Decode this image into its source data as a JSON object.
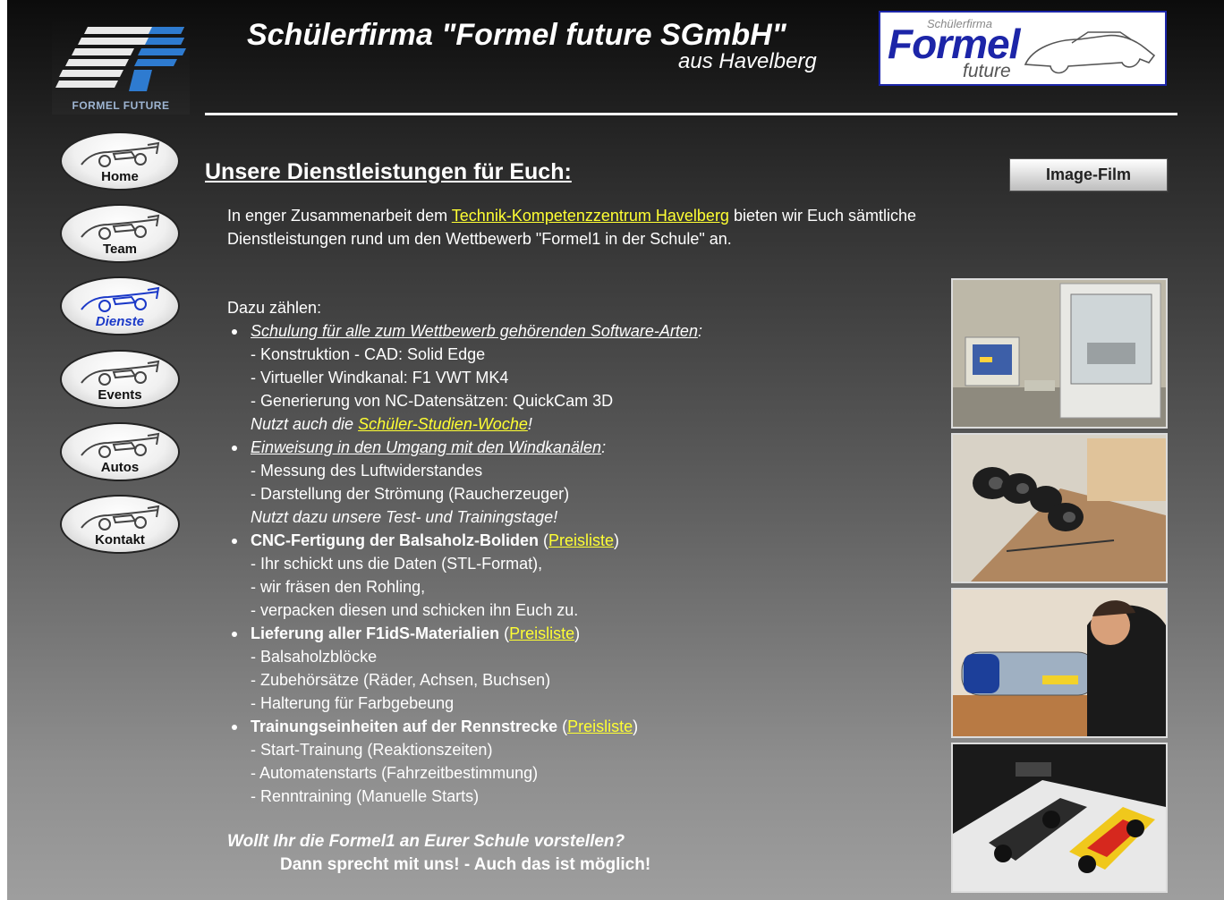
{
  "header": {
    "title": "Schülerfirma \"Formel future SGmbH\"",
    "subtitle": "aus Havelberg",
    "logo": {
      "caption": "FORMEL FUTURE",
      "icon": "ff-logo"
    },
    "banner": {
      "small_text": "Schülerfirma",
      "big_text": "Formel",
      "sub_text": "future",
      "icon": "car-outline"
    }
  },
  "nav": {
    "items": [
      {
        "label": "Home",
        "icon": "race-car-icon",
        "active": false
      },
      {
        "label": "Team",
        "icon": "race-car-icon",
        "active": false
      },
      {
        "label": "Dienste",
        "icon": "race-car-icon",
        "active": true
      },
      {
        "label": "Events",
        "icon": "race-car-icon",
        "active": false
      },
      {
        "label": "Autos",
        "icon": "race-car-icon",
        "active": false
      },
      {
        "label": "Kontakt",
        "icon": "race-car-icon",
        "active": false
      }
    ]
  },
  "main": {
    "heading": "Unsere Dienstleistungen für Euch:",
    "image_film_button": "Image-Film",
    "intro": {
      "before": "In enger Zusammenarbeit dem ",
      "link": "Technik-Kompetenzzentrum Havelberg",
      "after_line1": " bieten wir Euch sämtliche",
      "line2": "Dienstleistungen rund um den Wettbewerb \"Formel1 in der Schule\" an."
    },
    "dazu": "Dazu zählen:",
    "services": [
      {
        "title": "Schulung für alle zum Wettbewerb gehörenden Software-Arten",
        "suffix": ":",
        "lines": [
          "- Konstruktion - CAD: Solid Edge",
          "- Virtueller Windkanal: F1 VWT MK4",
          "- Generierung von NC-Datensätzen: QuickCam 3D"
        ],
        "note_before": "Nutzt auch die ",
        "note_link": "Schüler-Studien-Woche",
        "note_after": "!"
      },
      {
        "title": "Einweisung in den Umgang mit den Windkanälen",
        "suffix": ":",
        "lines": [
          "- Messung des Luftwiderstandes",
          "- Darstellung der Strömung (Raucherzeuger)"
        ],
        "note": "Nutzt dazu unsere Test- und Trainingstage!"
      },
      {
        "title": "CNC-Fertigung der Balsaholz-Boliden",
        "link": "Preisliste",
        "lines": [
          "- Ihr schickt uns die Daten (STL-Format),",
          "- wir fräsen den Rohling,",
          "- verpacken diesen und schicken ihn Euch zu."
        ]
      },
      {
        "title": "Lieferung aller F1idS-Materialien",
        "link": "Preisliste",
        "lines": [
          "- Balsaholzblöcke",
          "- Zubehörsätze (Räder, Achsen, Buchsen)",
          "- Halterung für Farbgebeung"
        ]
      },
      {
        "title": "Trainungseinheiten auf der Rennstrecke",
        "link": "Preisliste",
        "lines": [
          "- Start-Trainung (Reaktionszeiten)",
          "- Automatenstarts (Fahrzeitbestimmung)",
          "- Renntraining (Manuelle Starts)"
        ]
      }
    ],
    "closing_line1": "Wollt Ihr die Formel1 an Eurer Schule vorstellen?",
    "closing_line2": "Dann sprecht mit uns! - Auch das ist möglich!"
  },
  "colors": {
    "link": "#ffff33",
    "active_nav": "#1b39c8",
    "banner_border": "#1c25a8"
  }
}
